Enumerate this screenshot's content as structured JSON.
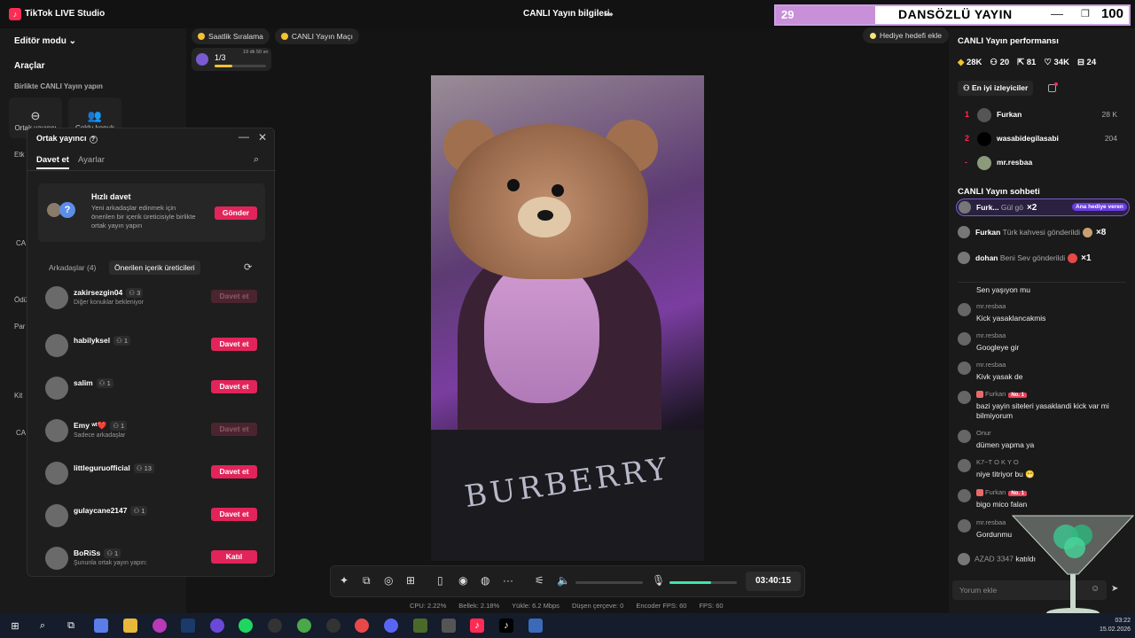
{
  "titlebar": {
    "app_name": "TikTok LIVE Studio",
    "stream_info": "CANLI Yayın bilgileri"
  },
  "overlay": {
    "left_number": "29",
    "title": "DANSÖZLÜ YAYIN",
    "right_number": "100"
  },
  "left_panel": {
    "mode": "Editör modu",
    "tools_title": "Araçlar",
    "collab_label": "Birlikte CANLI Yayın yapın",
    "tile1_label": "Ortak yayıncı",
    "tile2_label": "Çoklu konuk",
    "hidden_labels": [
      "Etk",
      "CA",
      "Ödü",
      "Par",
      "Kit",
      "CA Et"
    ]
  },
  "chips": {
    "hourly": "Saatlik Sıralama",
    "match": "CANLI Yayın Maçı",
    "goal": "Hediye hedefi ekle",
    "progress_count": "1/3",
    "progress_time": "19 dk 50 sn",
    "progress_fraction": 0.35
  },
  "cohost": {
    "title": "Ortak yayıncı",
    "tab_invite": "Davet et",
    "tab_settings": "Ayarlar",
    "quick_title": "Hızlı davet",
    "quick_desc": "Yeni arkadaşlar edinmek için önerilen bir içerik üreticisiyle birlikte ortak yayın yapın",
    "quick_button": "Gönder",
    "friends_tab": "Arkadaşlar (4)",
    "suggested_tab": "Önerilen içerik üreticileri",
    "rows": [
      {
        "name": "zakirsezgin04",
        "count": "3",
        "sub": "Diğer konuklar bekleniyor",
        "action": "Davet et",
        "enabled": false
      },
      {
        "name": "habilyksel",
        "count": "1",
        "sub": "",
        "action": "Davet et",
        "enabled": true
      },
      {
        "name": "salim",
        "count": "1",
        "sub": "",
        "action": "Davet et",
        "enabled": true
      },
      {
        "name": "Emy ʷᵗ❤️",
        "count": "1",
        "sub": "Sadece arkadaşlar",
        "action": "Davet et",
        "enabled": false
      },
      {
        "name": "littleguruofficial",
        "count": "13",
        "sub": "",
        "action": "Davet et",
        "enabled": true
      },
      {
        "name": "gulaycane2147",
        "count": "1",
        "sub": "",
        "action": "Davet et",
        "enabled": true
      },
      {
        "name": "BoRiSs",
        "count": "1",
        "sub": "Şununla ortak yayın yapın:",
        "action": "Katıl",
        "enabled": true
      }
    ]
  },
  "video": {
    "shirt_text": "BURBERRY"
  },
  "toolbar": {
    "timer": "03:40:15",
    "volume_fraction": 0,
    "mic_fraction": 0.62
  },
  "stats": {
    "cpu": "CPU: 2.22%",
    "memory": "Bellek: 2.18%",
    "upload": "Yükle: 6.2 Mbps",
    "dropped": "Düşen çerçeve: 0",
    "encoder_fps": "Encoder FPS: 60",
    "fps": "FPS: 60"
  },
  "right_panel": {
    "perf_title": "CANLI Yayın performansı",
    "perf": {
      "diamonds": "28K",
      "viewers": "20",
      "shares": "81",
      "likes": "34K",
      "gifts": "24"
    },
    "top_viewers": "En iyi izleyiciler",
    "ranking": [
      {
        "rank": "1",
        "name": "Furkan",
        "score": "28 K"
      },
      {
        "rank": "2",
        "name": "wasabidegilasabi",
        "score": "204"
      },
      {
        "rank": "-",
        "name": "mr.resbaa",
        "score": ""
      }
    ],
    "chat_title": "CANLI Yayın sohbeti",
    "gifts": [
      {
        "name": "Furk...",
        "desc": "Gül gö",
        "mult": "×2",
        "badge": "Ana hediye veren"
      },
      {
        "name": "Furkan",
        "desc": "Türk kahvesi gönderildi",
        "mult": "×8"
      },
      {
        "name": "dohan",
        "desc": "Beni Sev gönderildi",
        "mult": "×1"
      }
    ],
    "messages": [
      {
        "user": "",
        "text": "Sen yaşıyon mu"
      },
      {
        "user": "mr.resbaa",
        "text": "Kick yasaklancakmis"
      },
      {
        "user": "mr.resbaa",
        "text": "Googleye gir"
      },
      {
        "user": "mr.resbaa",
        "text": "Kivk yasak de"
      },
      {
        "user": "Furkan",
        "level": "No. 1",
        "text": "bazi yayin siteleri yasaklandi kick var mi bilmiyorum"
      },
      {
        "user": "Onur",
        "text": "dümen yapma ya"
      },
      {
        "user": "K7~T O K Y O",
        "text": "niye titriyor bu 😁"
      },
      {
        "user": "Furkan",
        "level": "No. 1",
        "text": "bigo mico falan"
      },
      {
        "user": "mr.resbaa",
        "text": "Gordunmu"
      }
    ],
    "join_user": "AZAD 3347",
    "join_text": "katıldı",
    "comment_placeholder": "Yorum ekle"
  },
  "taskbar": {
    "time": "03:22",
    "date": "15.02.2026"
  },
  "colors": {
    "accent": "#fe2c55",
    "invite_button": "#e2245a",
    "mic_level": "#3ee6a8"
  }
}
